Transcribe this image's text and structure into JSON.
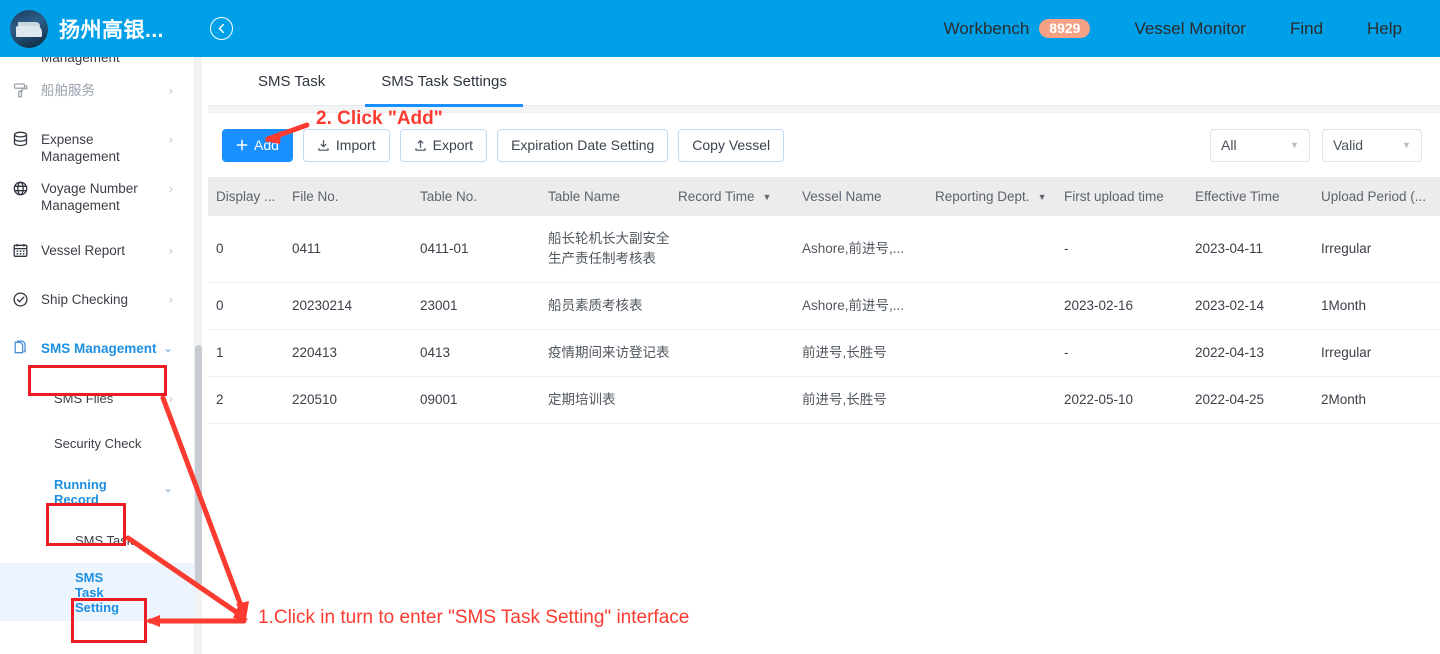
{
  "topbar": {
    "brand_title": "扬州高银...",
    "logo_icon": "vessel-avatar-icon",
    "back_icon": "back-arrow-circle-icon",
    "nav": [
      {
        "label": "Workbench",
        "badge": "8929"
      },
      {
        "label": "Vessel Monitor",
        "badge": ""
      },
      {
        "label": "Find",
        "badge": ""
      },
      {
        "label": "Help",
        "badge": ""
      }
    ]
  },
  "sidebar": {
    "clipped_top_label": "Management",
    "items": [
      {
        "label": "船舶服务",
        "icon": "paint-roller-icon",
        "chevron": "›",
        "muted": true
      },
      {
        "label": "Expense Management",
        "icon": "database-icon",
        "chevron": "›",
        "muted": false
      },
      {
        "label": "Voyage Number Management",
        "icon": "globe-icon",
        "chevron": "›",
        "muted": false
      },
      {
        "label": "Vessel Report",
        "icon": "calendar-icon",
        "chevron": "›",
        "muted": false
      },
      {
        "label": "Ship Checking",
        "icon": "check-circle-icon",
        "chevron": "›",
        "muted": false
      },
      {
        "label": "SMS Management",
        "icon": "files-icon",
        "chevron": "⌄",
        "muted": false
      }
    ],
    "sub_items": [
      {
        "label": "SMS Files",
        "chevron": "›",
        "highlight": false,
        "active": false
      },
      {
        "label": "Security Check",
        "chevron": "",
        "highlight": false,
        "active": false
      },
      {
        "label": "Running Record",
        "chevron": "⌄",
        "highlight": true,
        "active": false
      },
      {
        "label": "SMS Task",
        "chevron": "",
        "highlight": false,
        "active": false
      },
      {
        "label": "SMS Task Setting",
        "chevron": "",
        "highlight": true,
        "active": true
      }
    ]
  },
  "main": {
    "tabs": [
      {
        "label": "SMS Task",
        "active": false
      },
      {
        "label": "SMS Task Settings",
        "active": true
      }
    ],
    "toolbar": {
      "add_label": "Add",
      "add_icon": "plus-icon",
      "import_label": "Import",
      "import_icon": "download-icon",
      "export_label": "Export",
      "export_icon": "upload-icon",
      "expiration_label": "Expiration Date Setting",
      "copy_vessel_label": "Copy Vessel"
    },
    "filters": [
      {
        "value": "All",
        "caret_icon": "chevron-down-icon"
      },
      {
        "value": "Valid",
        "caret_icon": "chevron-down-icon"
      }
    ],
    "table": {
      "columns": [
        {
          "label": "Display ...",
          "sortable": false
        },
        {
          "label": "File No.",
          "sortable": false
        },
        {
          "label": "Table No.",
          "sortable": false
        },
        {
          "label": "Table Name",
          "sortable": false
        },
        {
          "label": "Record Time",
          "sortable": true
        },
        {
          "label": "Vessel Name",
          "sortable": false
        },
        {
          "label": "Reporting Dept.",
          "sortable": true
        },
        {
          "label": "First upload time",
          "sortable": false
        },
        {
          "label": "Effective Time",
          "sortable": false
        },
        {
          "label": "Upload Period (...",
          "sortable": false
        }
      ],
      "rows": [
        {
          "display": "0",
          "file_no": "0411",
          "table_no": "0411-01",
          "table_name": "船长轮机长大副安全生产责任制考核表",
          "record_time": "",
          "vessel_name": "Ashore,前进号,...",
          "reporting_dept": "",
          "first_upload_time": "-",
          "effective_time": "2023-04-11",
          "upload_period": "Irregular"
        },
        {
          "display": "0",
          "file_no": "20230214",
          "table_no": "23001",
          "table_name": "船员素质考核表",
          "record_time": "",
          "vessel_name": "Ashore,前进号,...",
          "reporting_dept": "",
          "first_upload_time": "2023-02-16",
          "effective_time": "2023-02-14",
          "upload_period": "1Month"
        },
        {
          "display": "1",
          "file_no": "220413",
          "table_no": "0413",
          "table_name": "疫情期间来访登记表",
          "record_time": "",
          "vessel_name": "前进号,长胜号",
          "reporting_dept": "",
          "first_upload_time": "-",
          "effective_time": "2022-04-13",
          "upload_period": "Irregular"
        },
        {
          "display": "2",
          "file_no": "220510",
          "table_no": "09001",
          "table_name": "定期培训表",
          "record_time": "",
          "vessel_name": "前进号,长胜号",
          "reporting_dept": "",
          "first_upload_time": "2022-05-10",
          "effective_time": "2022-04-25",
          "upload_period": "2Month"
        }
      ]
    }
  },
  "annotations": {
    "step2": "2. Click \"Add\"",
    "step1": "1.Click in turn to enter \"SMS Task Setting\" interface",
    "color": "#fb3b30",
    "box_color": "#ed1c24"
  }
}
